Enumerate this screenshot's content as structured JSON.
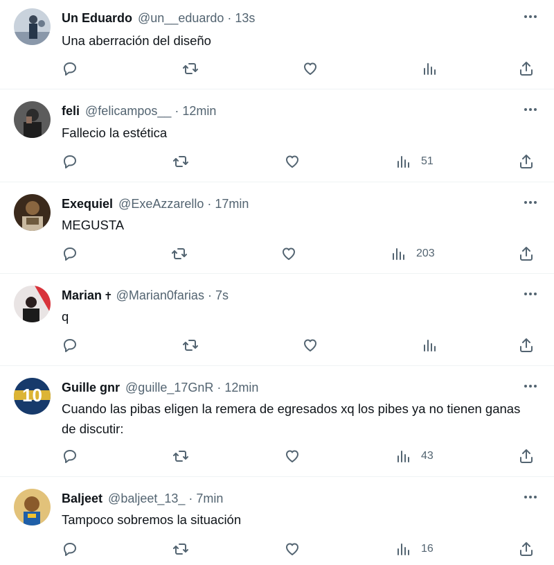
{
  "tweets": [
    {
      "name": "Un Eduardo",
      "badge": "",
      "handle": "@un__eduardo",
      "time": "13s",
      "text": "Una aberración del diseño",
      "views": "",
      "avatar_color": "#7a8aa0"
    },
    {
      "name": "feli",
      "badge": "",
      "handle": "@felicampos__",
      "time": "12min",
      "text": "Fallecio la estética",
      "views": "51",
      "avatar_color": "#3a3a3a"
    },
    {
      "name": "Exequiel",
      "badge": "",
      "handle": "@ExeAzzarello",
      "time": "17min",
      "text": "MEGUSTA",
      "views": "203",
      "avatar_color": "#6b4a2e"
    },
    {
      "name": "Marian",
      "badge": "✝",
      "handle": "@Marian0farias",
      "time": "7s",
      "text": "q",
      "views": "",
      "avatar_color": "#d8333b"
    },
    {
      "name": "Guille gnr",
      "badge": "",
      "handle": "@guille_17GnR",
      "time": "12min",
      "text": "Cuando las pibas eligen la remera de egresados xq los pibes ya no tienen ganas de discutir:",
      "views": "43",
      "avatar_color": "#173a6b",
      "avatar_text": "10"
    },
    {
      "name": "Baljeet",
      "badge": "",
      "handle": "@baljeet_13_",
      "time": "7min",
      "text": "Tampoco sobremos la situación",
      "views": "16",
      "avatar_color": "#d9a441"
    }
  ],
  "colors": {
    "text": "#0f1419",
    "secondary": "#536471",
    "divider": "#eff3f4"
  }
}
